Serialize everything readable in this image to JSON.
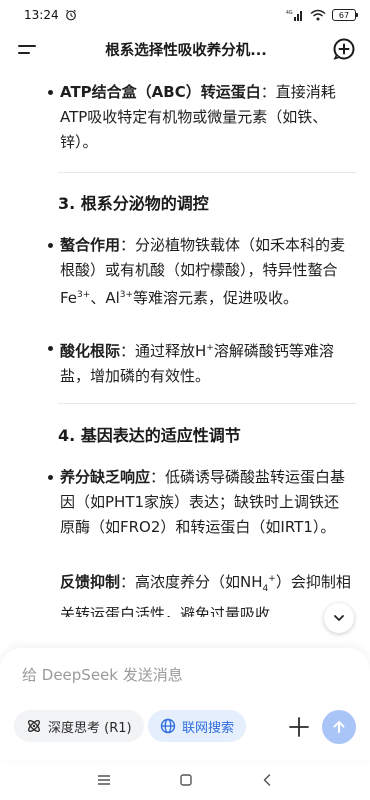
{
  "status": {
    "time": "13:24",
    "network": "4G",
    "battery": "67"
  },
  "header": {
    "title": "根系选择性吸收养分机..."
  },
  "content": {
    "abc_item": {
      "term": "ATP结合盒（ABC）转运蛋白",
      "text": "：直接消耗ATP吸收特定有机物或微量元素（如铁、锌）。"
    },
    "section3": {
      "title": "3. 根系分泌物的调控",
      "item1_term": "螯合作用",
      "item1_text_a": "：分泌植物铁载体（如禾本科的麦根酸）或有机酸（如柠檬酸），特异性螯合Fe",
      "item1_sup1": "3+",
      "item1_text_b": "、Al",
      "item1_sup2": "3+",
      "item1_text_c": "等难溶元素，促进吸收。",
      "item2_term": "酸化根际",
      "item2_text_a": "：通过释放H",
      "item2_sup": "+",
      "item2_text_b": "溶解磷酸钙等难溶盐，增加磷的有效性。"
    },
    "section4": {
      "title": "4. 基因表达的适应性调节",
      "item1_term": "养分缺乏响应",
      "item1_text": "：低磷诱导磷酸盐转运蛋白基因（如PHT1家族）表达；缺铁时上调铁还原酶（如FRO2）和转运蛋白（如IRT1）。",
      "item2_term": "反馈抑制",
      "item2_text_a": "：高浓度养分（如NH",
      "item2_sub": "4",
      "item2_sup": "+",
      "item2_text_b": "）会抑制相关转运蛋白活性，避免过量吸收"
    }
  },
  "composer": {
    "placeholder": "给 DeepSeek 发送消息",
    "think_label": "深度思考 (R1)",
    "search_label": "联网搜索"
  },
  "colors": {
    "accent": "#2f6de1",
    "send_disabled": "#a9c4f6",
    "chip_active_bg": "#e5eefc"
  }
}
